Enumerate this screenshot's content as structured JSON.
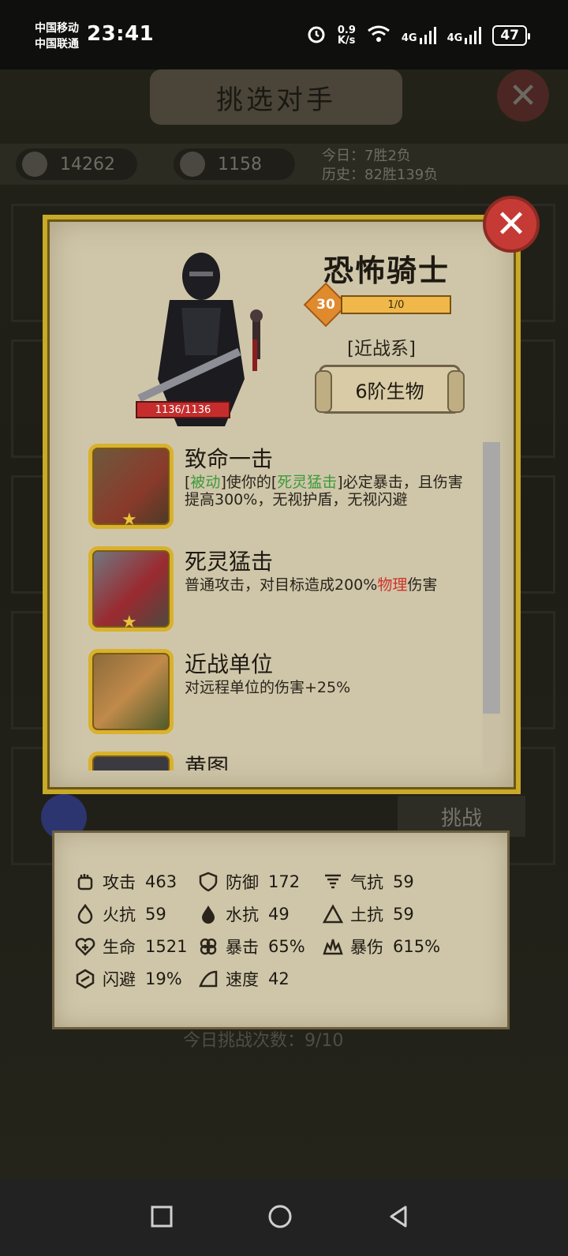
{
  "status_bar": {
    "carrier_1": "中国移动",
    "carrier_2": "中国联通",
    "time": "23:41",
    "net_speed_value": "0.9",
    "net_speed_unit": "K/s",
    "signal_label_1": "4G",
    "signal_label_2": "4G",
    "battery": "47"
  },
  "background": {
    "title": "挑选对手",
    "resource_1": "14262",
    "resource_2": "1158",
    "today_record": "今日：7胜2负",
    "history_record": "历史：82胜139负",
    "challenge_button": "挑战",
    "challenge_count": "今日挑战次数：9/10"
  },
  "unit": {
    "name": "恐怖骑士",
    "level": "30",
    "exp": "1/0",
    "type": "[近战系]",
    "tier": "6阶生物",
    "hp": "1136/1136"
  },
  "skills": [
    {
      "title": "致命一击",
      "desc_p1": "[",
      "desc_k1": "被动",
      "desc_p2": "]使你的[",
      "desc_k2": "死灵猛击",
      "desc_p3": "]必定暴击，且伤害提高300%，无视护盾，无视闪避"
    },
    {
      "title": "死灵猛击",
      "desc_p1": "普通攻击，对目标造成200%",
      "desc_k1": "物理",
      "desc_p2": "伤害"
    },
    {
      "title": "近战单位",
      "desc": "对远程单位的伤害+25%"
    },
    {
      "title": "黄图"
    }
  ],
  "stats": {
    "attack": {
      "label": "攻击",
      "value": "463",
      "icon": "fist-icon"
    },
    "defense": {
      "label": "防御",
      "value": "172",
      "icon": "shield-icon"
    },
    "wind_res": {
      "label": "气抗",
      "value": "59",
      "icon": "tornado-icon"
    },
    "fire_res": {
      "label": "火抗",
      "value": "59",
      "icon": "flame-icon"
    },
    "water_res": {
      "label": "水抗",
      "value": "49",
      "icon": "droplet-icon"
    },
    "earth_res": {
      "label": "土抗",
      "value": "59",
      "icon": "mountain-icon"
    },
    "hp": {
      "label": "生命",
      "value": "1521",
      "icon": "heart-plus-icon"
    },
    "crit": {
      "label": "暴击",
      "value": "65%",
      "icon": "crit-icon"
    },
    "crit_dmg": {
      "label": "暴伤",
      "value": "615%",
      "icon": "burst-icon"
    },
    "dodge": {
      "label": "闪避",
      "value": "19%",
      "icon": "dodge-icon"
    },
    "speed": {
      "label": "速度",
      "value": "42",
      "icon": "speed-icon"
    }
  },
  "colors": {
    "keyword_green": "#3c9a3a",
    "keyword_red": "#d1322a",
    "gold_frame": "#c8a928",
    "close_red": "#c63a35"
  }
}
